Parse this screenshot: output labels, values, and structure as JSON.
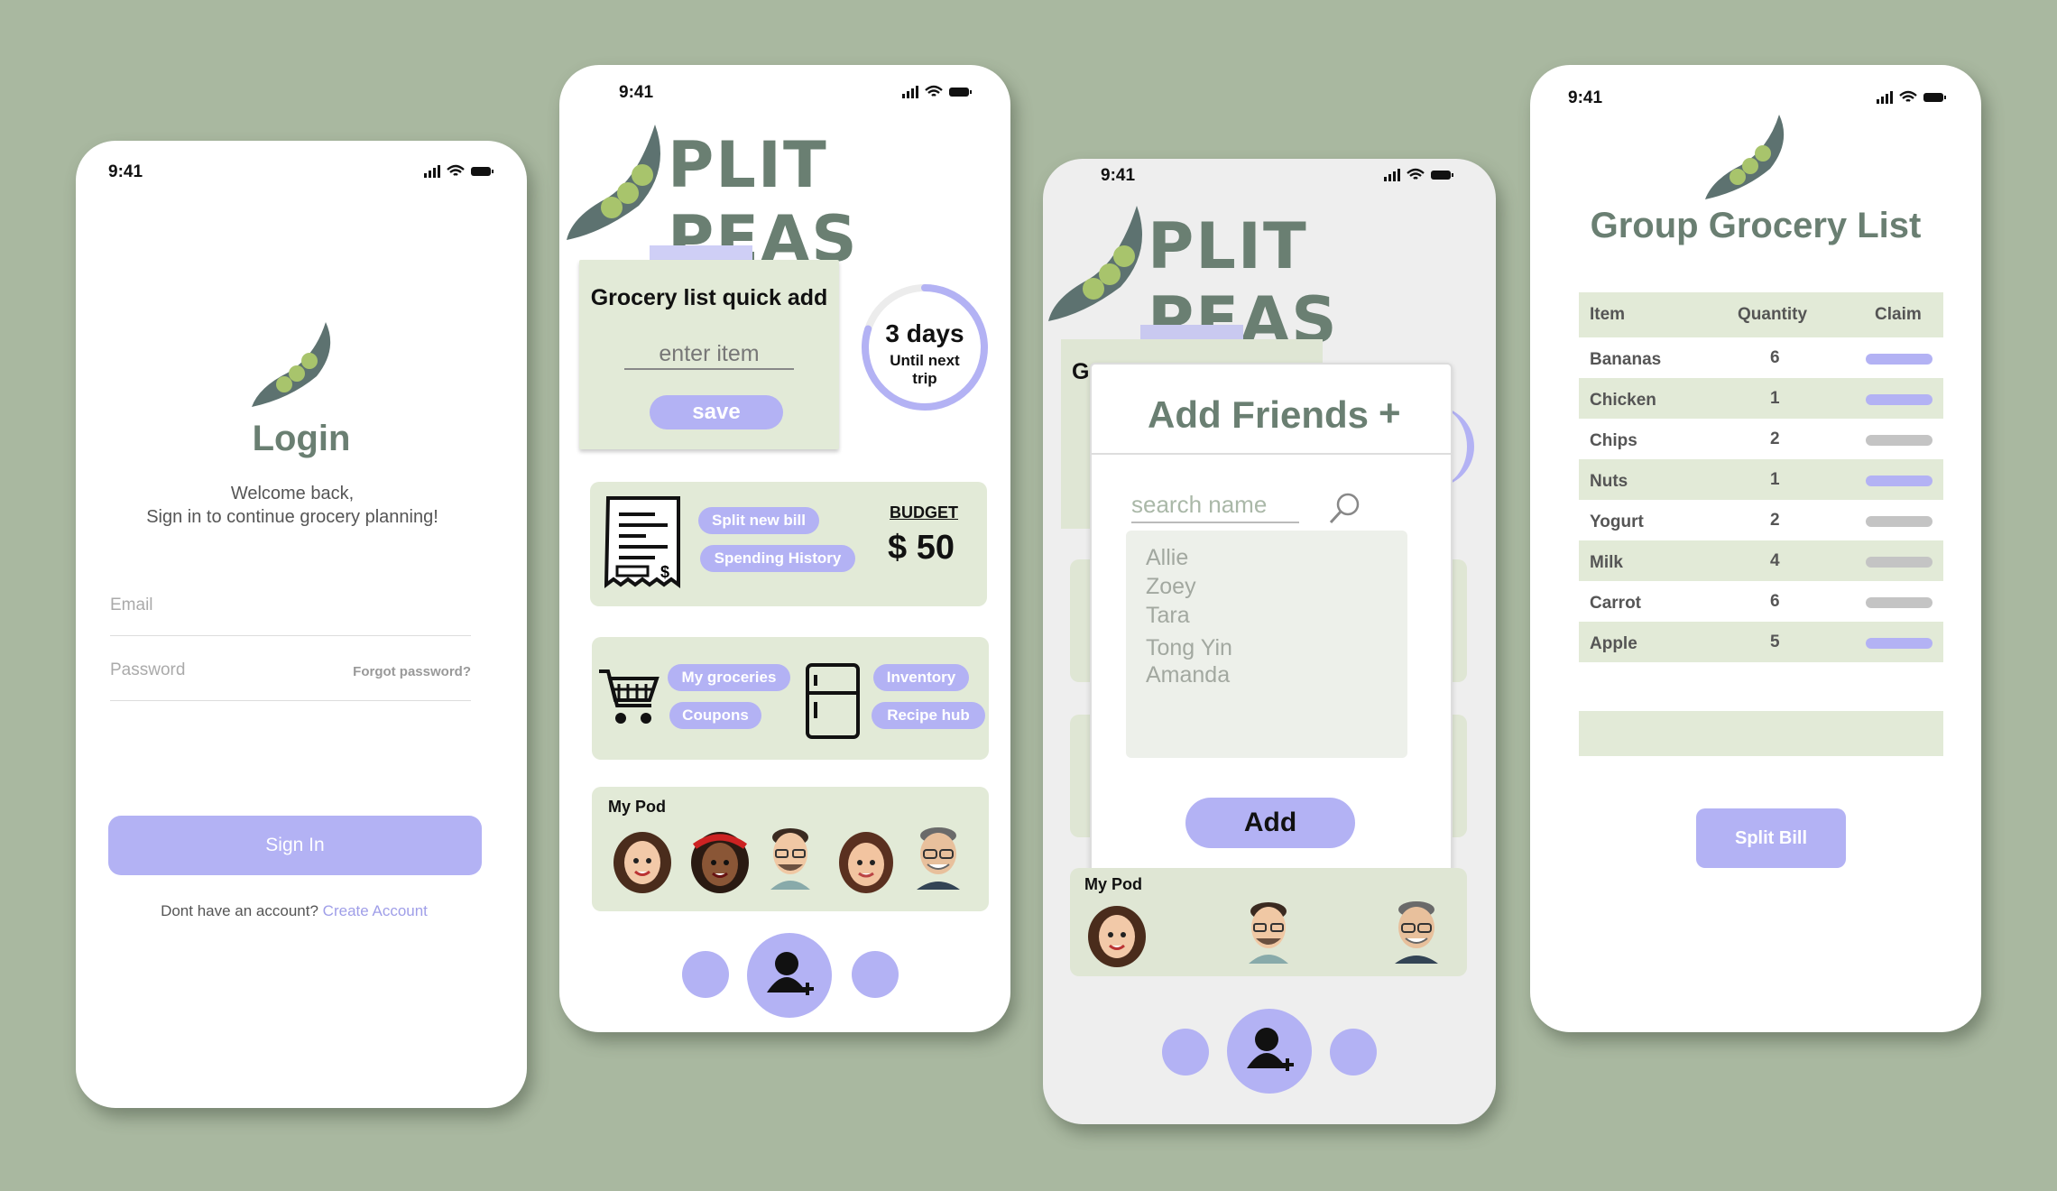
{
  "status": {
    "time": "9:41"
  },
  "login": {
    "title": "Login",
    "welcome": "Welcome back,",
    "subtitle": "Sign in to continue grocery planning!",
    "email_placeholder": "Email",
    "password_placeholder": "Password",
    "forgot": "Forgot password?",
    "sign_in": "Sign In",
    "no_account": "Dont have an account?",
    "create": "Create Account"
  },
  "home": {
    "brand": "PLIT PEAS",
    "quick_add_title": "Grocery list quick add",
    "enter_item": "enter item",
    "save": "save",
    "days": "3 days",
    "days_sub1": "Until next",
    "days_sub2": "trip",
    "days_progress": 0.8,
    "split_new_bill": "Split new bill",
    "spending_history": "Spending History",
    "budget_label": "BUDGET",
    "budget_value": "$ 50",
    "my_groceries": "My groceries",
    "coupons": "Coupons",
    "inventory": "Inventory",
    "recipe_hub": "Recipe hub",
    "my_pod": "My Pod"
  },
  "friends": {
    "brand": "PLIT PEAS",
    "title": "Add Friends",
    "plus": "+",
    "search_placeholder": "search name",
    "names": [
      "Allie",
      "Zoey",
      "Tara",
      "Tong Yin",
      "Amanda"
    ],
    "add": "Add",
    "peek_letter": "G",
    "my_pod": "My Pod"
  },
  "grocery": {
    "title": "Group Grocery List",
    "headers": [
      "Item",
      "Quantity",
      "Claim"
    ],
    "rows": [
      {
        "item": "Bananas",
        "qty": "6",
        "claimed": true
      },
      {
        "item": "Chicken",
        "qty": "1",
        "claimed": true
      },
      {
        "item": "Chips",
        "qty": "2",
        "claimed": false
      },
      {
        "item": "Nuts",
        "qty": "1",
        "claimed": true
      },
      {
        "item": "Yogurt",
        "qty": "2",
        "claimed": false
      },
      {
        "item": "Milk",
        "qty": "4",
        "claimed": false
      },
      {
        "item": "Carrot",
        "qty": "6",
        "claimed": false
      },
      {
        "item": "Apple",
        "qty": "5",
        "claimed": true
      }
    ],
    "split_bill": "Split Bill"
  },
  "colors": {
    "accent": "#b3b2f4",
    "background": "#a9b8a0",
    "card": "#e2ead7",
    "brand": "#6a7f72"
  }
}
